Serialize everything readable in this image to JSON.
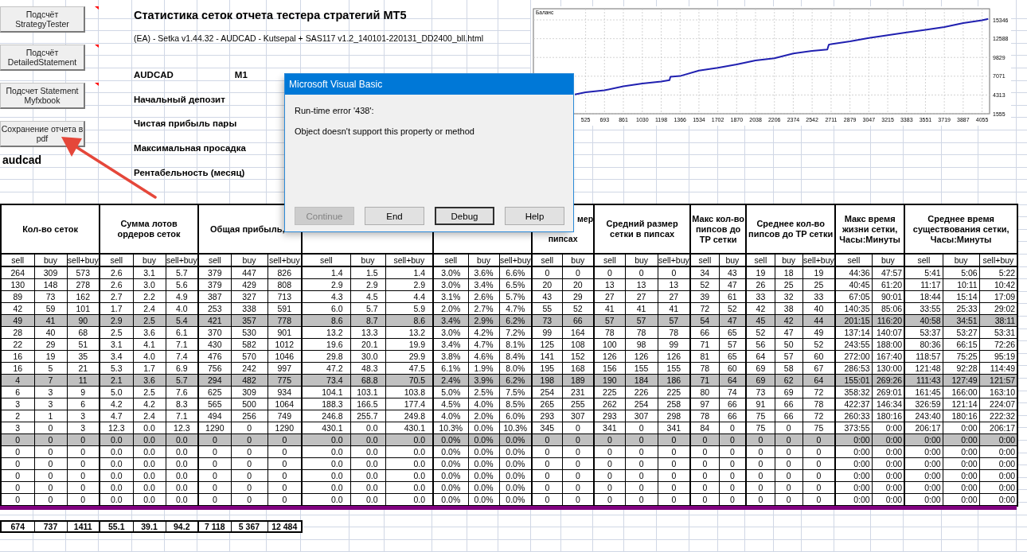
{
  "toolbar_buttons": [
    {
      "label": "Подсчёт StrategyTester",
      "comment_marker": true
    },
    {
      "label": "Подсчёт DetailedStatement",
      "comment_marker": true
    },
    {
      "label": "Подсчет Statement Myfxbook",
      "comment_marker": true
    },
    {
      "label": "Сохранение отчета в pdf",
      "comment_marker": false
    }
  ],
  "sheet_label": "audcad",
  "report": {
    "title": "Статистика сеток отчета тестера стратегий MT5",
    "file_name": "(EA) - Setka v1.44.32 - AUDCAD - Kutsepal + SAS117 v1.2_140101-220131_DD2400_bll.html",
    "symbol": "AUDCAD",
    "timeframe": "M1",
    "fields": [
      "Начальный депозит",
      "Чистая прибыль пары",
      "Максимальная просадка",
      "Рентабельность (месяц)"
    ]
  },
  "chart": {
    "chart_data": {
      "type": "line",
      "title": "Баланс",
      "x": [
        429,
        525,
        693,
        861,
        1030,
        1198,
        1272,
        1280,
        1366,
        1534,
        1702,
        1870,
        2038,
        2206,
        2374,
        2542,
        2677,
        2690,
        2711,
        2879,
        3047,
        3215,
        3383,
        3551,
        3719,
        3887,
        4055,
        4110
      ],
      "values": [
        4400,
        4700,
        5000,
        5600,
        6000,
        6300,
        6500,
        7000,
        7100,
        7900,
        8300,
        8800,
        9400,
        9700,
        10400,
        10800,
        11000,
        11700,
        11800,
        12200,
        12700,
        13100,
        13500,
        13900,
        14300,
        14900,
        15300,
        15500
      ],
      "color": "#2020b0",
      "xlim": [
        60,
        4122
      ],
      "ylim": [
        1555,
        16988
      ],
      "xticks": [
        525,
        693,
        861,
        1030,
        1198,
        1366,
        1534,
        1702,
        1870,
        2038,
        2206,
        2374,
        2542,
        2711,
        2879,
        3047,
        3215,
        3383,
        3551,
        3719,
        3887,
        4055
      ],
      "yticks": [
        1555,
        4313,
        7071,
        9829,
        12588,
        15346
      ],
      "grid": true
    }
  },
  "table": {
    "groups": [
      {
        "title": "Кол-во сеток",
        "columns": [
          "sell",
          "buy",
          "sell+buy"
        ]
      },
      {
        "title": "Сумма лотов ордеров сеток",
        "columns": [
          "sell",
          "buy",
          "sell+buy"
        ]
      },
      {
        "title": "Общая прибыль,",
        "columns": [
          "sell",
          "buy",
          "sell+buy"
        ]
      },
      {
        "columns": [
          "sell",
          "buy",
          "sell+buy"
        ]
      },
      {
        "columns": [
          "sell",
          "buy",
          "sell+buy"
        ]
      },
      {
        "title_fragments": [
          "мер",
          "пипсах"
        ],
        "columns": [
          "sell",
          "buy"
        ]
      },
      {
        "title": "Средний размер сетки в пипсах",
        "columns": [
          "sell",
          "buy",
          "sell+buy"
        ]
      },
      {
        "title": "Макс кол-во пипсов до TP сетки",
        "columns": [
          "sell",
          "buy"
        ]
      },
      {
        "title": "Среднее кол-во пипсов до TP сетки",
        "columns": [
          "sell",
          "buy",
          "sell+buy"
        ]
      },
      {
        "title": "Макс время жизни сетки, Часы:Минуты",
        "columns": [
          "sell",
          "buy"
        ]
      },
      {
        "title": "Среднее время существования сетки, Часы:Минуты",
        "columns": [
          "sell",
          "buy",
          "sell+buy"
        ]
      }
    ],
    "rows": [
      {
        "highlighted": false,
        "cells": [
          "264",
          "309",
          "573",
          "2.6",
          "3.1",
          "5.7",
          "379",
          "447",
          "826",
          "1.4",
          "1.5",
          "1.4",
          "3.0%",
          "3.6%",
          "6.6%",
          "0",
          "0",
          "0",
          "0",
          "0",
          "34",
          "43",
          "19",
          "18",
          "19",
          "44:36",
          "47:57",
          "5:41",
          "5:06",
          "5:22"
        ]
      },
      {
        "highlighted": false,
        "cells": [
          "130",
          "148",
          "278",
          "2.6",
          "3.0",
          "5.6",
          "379",
          "429",
          "808",
          "2.9",
          "2.9",
          "2.9",
          "3.0%",
          "3.4%",
          "6.5%",
          "20",
          "20",
          "13",
          "13",
          "13",
          "52",
          "47",
          "26",
          "25",
          "25",
          "40:45",
          "61:20",
          "11:17",
          "10:11",
          "10:42"
        ]
      },
      {
        "highlighted": false,
        "cells": [
          "89",
          "73",
          "162",
          "2.7",
          "2.2",
          "4.9",
          "387",
          "327",
          "713",
          "4.3",
          "4.5",
          "4.4",
          "3.1%",
          "2.6%",
          "5.7%",
          "43",
          "29",
          "27",
          "27",
          "27",
          "39",
          "61",
          "33",
          "32",
          "33",
          "67:05",
          "90:01",
          "18:44",
          "15:14",
          "17:09"
        ]
      },
      {
        "highlighted": false,
        "cells": [
          "42",
          "59",
          "101",
          "1.7",
          "2.4",
          "4.0",
          "253",
          "338",
          "591",
          "6.0",
          "5.7",
          "5.9",
          "2.0%",
          "2.7%",
          "4.7%",
          "55",
          "52",
          "41",
          "41",
          "41",
          "72",
          "52",
          "42",
          "38",
          "40",
          "140:35",
          "85:06",
          "33:55",
          "25:33",
          "29:02"
        ]
      },
      {
        "highlighted": true,
        "cells": [
          "49",
          "41",
          "90",
          "2.9",
          "2.5",
          "5.4",
          "421",
          "357",
          "778",
          "8.6",
          "8.7",
          "8.6",
          "3.4%",
          "2.9%",
          "6.2%",
          "73",
          "66",
          "57",
          "57",
          "57",
          "54",
          "47",
          "45",
          "42",
          "44",
          "201:15",
          "116:20",
          "40:58",
          "34:51",
          "38:11"
        ]
      },
      {
        "highlighted": false,
        "cells": [
          "28",
          "40",
          "68",
          "2.5",
          "3.6",
          "6.1",
          "370",
          "530",
          "901",
          "13.2",
          "13.3",
          "13.2",
          "3.0%",
          "4.2%",
          "7.2%",
          "99",
          "164",
          "78",
          "78",
          "78",
          "66",
          "65",
          "52",
          "47",
          "49",
          "137:14",
          "140:07",
          "53:37",
          "53:27",
          "53:31"
        ]
      },
      {
        "highlighted": false,
        "cells": [
          "22",
          "29",
          "51",
          "3.1",
          "4.1",
          "7.1",
          "430",
          "582",
          "1012",
          "19.6",
          "20.1",
          "19.9",
          "3.4%",
          "4.7%",
          "8.1%",
          "125",
          "108",
          "100",
          "98",
          "99",
          "71",
          "57",
          "56",
          "50",
          "52",
          "243:55",
          "188:00",
          "80:36",
          "66:15",
          "72:26"
        ]
      },
      {
        "highlighted": false,
        "cells": [
          "16",
          "19",
          "35",
          "3.4",
          "4.0",
          "7.4",
          "476",
          "570",
          "1046",
          "29.8",
          "30.0",
          "29.9",
          "3.8%",
          "4.6%",
          "8.4%",
          "141",
          "152",
          "126",
          "126",
          "126",
          "81",
          "65",
          "64",
          "57",
          "60",
          "272:00",
          "167:40",
          "118:57",
          "75:25",
          "95:19"
        ]
      },
      {
        "highlighted": false,
        "cells": [
          "16",
          "5",
          "21",
          "5.3",
          "1.7",
          "6.9",
          "756",
          "242",
          "997",
          "47.2",
          "48.3",
          "47.5",
          "6.1%",
          "1.9%",
          "8.0%",
          "195",
          "168",
          "156",
          "155",
          "155",
          "78",
          "60",
          "69",
          "58",
          "67",
          "286:53",
          "130:00",
          "121:48",
          "92:28",
          "114:49"
        ]
      },
      {
        "highlighted": true,
        "cells": [
          "4",
          "7",
          "11",
          "2.1",
          "3.6",
          "5.7",
          "294",
          "482",
          "775",
          "73.4",
          "68.8",
          "70.5",
          "2.4%",
          "3.9%",
          "6.2%",
          "198",
          "189",
          "190",
          "184",
          "186",
          "71",
          "64",
          "69",
          "62",
          "64",
          "155:01",
          "269:26",
          "111:43",
          "127:49",
          "121:57"
        ]
      },
      {
        "highlighted": false,
        "cells": [
          "6",
          "3",
          "9",
          "5.0",
          "2.5",
          "7.6",
          "625",
          "309",
          "934",
          "104.1",
          "103.1",
          "103.8",
          "5.0%",
          "2.5%",
          "7.5%",
          "254",
          "231",
          "225",
          "226",
          "225",
          "80",
          "74",
          "73",
          "69",
          "72",
          "358:32",
          "269:01",
          "161:45",
          "166:00",
          "163:10"
        ]
      },
      {
        "highlighted": false,
        "cells": [
          "3",
          "3",
          "6",
          "4.2",
          "4.2",
          "8.3",
          "565",
          "500",
          "1064",
          "188.3",
          "166.5",
          "177.4",
          "4.5%",
          "4.0%",
          "8.5%",
          "265",
          "255",
          "262",
          "254",
          "258",
          "97",
          "66",
          "91",
          "66",
          "78",
          "422:37",
          "146:34",
          "326:59",
          "121:14",
          "224:07"
        ]
      },
      {
        "highlighted": false,
        "cells": [
          "2",
          "1",
          "3",
          "4.7",
          "2.4",
          "7.1",
          "494",
          "256",
          "749",
          "246.8",
          "255.7",
          "249.8",
          "4.0%",
          "2.0%",
          "6.0%",
          "293",
          "307",
          "293",
          "307",
          "298",
          "78",
          "66",
          "75",
          "66",
          "72",
          "260:33",
          "180:16",
          "243:40",
          "180:16",
          "222:32"
        ]
      },
      {
        "highlighted": false,
        "cells": [
          "3",
          "0",
          "3",
          "12.3",
          "0.0",
          "12.3",
          "1290",
          "0",
          "1290",
          "430.1",
          "0.0",
          "430.1",
          "10.3%",
          "0.0%",
          "10.3%",
          "345",
          "0",
          "341",
          "0",
          "341",
          "84",
          "0",
          "75",
          "0",
          "75",
          "373:55",
          "0:00",
          "206:17",
          "0:00",
          "206:17"
        ]
      },
      {
        "highlighted": true,
        "cells": [
          "0",
          "0",
          "0",
          "0.0",
          "0.0",
          "0.0",
          "0",
          "0",
          "0",
          "0.0",
          "0.0",
          "0.0",
          "0.0%",
          "0.0%",
          "0.0%",
          "0",
          "0",
          "0",
          "0",
          "0",
          "0",
          "0",
          "0",
          "0",
          "0",
          "0:00",
          "0:00",
          "0:00",
          "0:00",
          "0:00"
        ]
      },
      {
        "highlighted": false,
        "cells": [
          "0",
          "0",
          "0",
          "0.0",
          "0.0",
          "0.0",
          "0",
          "0",
          "0",
          "0.0",
          "0.0",
          "0.0",
          "0.0%",
          "0.0%",
          "0.0%",
          "0",
          "0",
          "0",
          "0",
          "0",
          "0",
          "0",
          "0",
          "0",
          "0",
          "0:00",
          "0:00",
          "0:00",
          "0:00",
          "0:00"
        ]
      },
      {
        "highlighted": false,
        "cells": [
          "0",
          "0",
          "0",
          "0.0",
          "0.0",
          "0.0",
          "0",
          "0",
          "0",
          "0.0",
          "0.0",
          "0.0",
          "0.0%",
          "0.0%",
          "0.0%",
          "0",
          "0",
          "0",
          "0",
          "0",
          "0",
          "0",
          "0",
          "0",
          "0",
          "0:00",
          "0:00",
          "0:00",
          "0:00",
          "0:00"
        ]
      },
      {
        "highlighted": false,
        "cells": [
          "0",
          "0",
          "0",
          "0.0",
          "0.0",
          "0.0",
          "0",
          "0",
          "0",
          "0.0",
          "0.0",
          "0.0",
          "0.0%",
          "0.0%",
          "0.0%",
          "0",
          "0",
          "0",
          "0",
          "0",
          "0",
          "0",
          "0",
          "0",
          "0",
          "0:00",
          "0:00",
          "0:00",
          "0:00",
          "0:00"
        ]
      },
      {
        "highlighted": false,
        "cells": [
          "0",
          "0",
          "0",
          "0.0",
          "0.0",
          "0.0",
          "0",
          "0",
          "0",
          "0.0",
          "0.0",
          "0.0",
          "0.0%",
          "0.0%",
          "0.0%",
          "0",
          "0",
          "0",
          "0",
          "0",
          "0",
          "0",
          "0",
          "0",
          "0",
          "0:00",
          "0:00",
          "0:00",
          "0:00",
          "0:00"
        ]
      },
      {
        "highlighted": false,
        "cells": [
          "0",
          "0",
          "0",
          "0.0",
          "0.0",
          "0.0",
          "0",
          "0",
          "0",
          "0.0",
          "0.0",
          "0.0",
          "0.0%",
          "0.0%",
          "0.0%",
          "0",
          "0",
          "0",
          "0",
          "0",
          "0",
          "0",
          "0",
          "0",
          "0",
          "0:00",
          "0:00",
          "0:00",
          "0:00",
          "0:00"
        ]
      }
    ],
    "totals": [
      "674",
      "737",
      "1411",
      "55.1",
      "39.1",
      "94.2",
      "7 118",
      "5 367",
      "12 484"
    ]
  },
  "dialog": {
    "title": "Microsoft Visual Basic",
    "message_lines": [
      "Run-time error '438':",
      "Object doesn't support this property or method"
    ],
    "buttons": [
      {
        "label": "Continue",
        "disabled": true,
        "default": false
      },
      {
        "label": "End",
        "disabled": false,
        "default": false
      },
      {
        "label": "Debug",
        "disabled": false,
        "default": true
      },
      {
        "label": "Help",
        "disabled": false,
        "default": false
      }
    ]
  }
}
